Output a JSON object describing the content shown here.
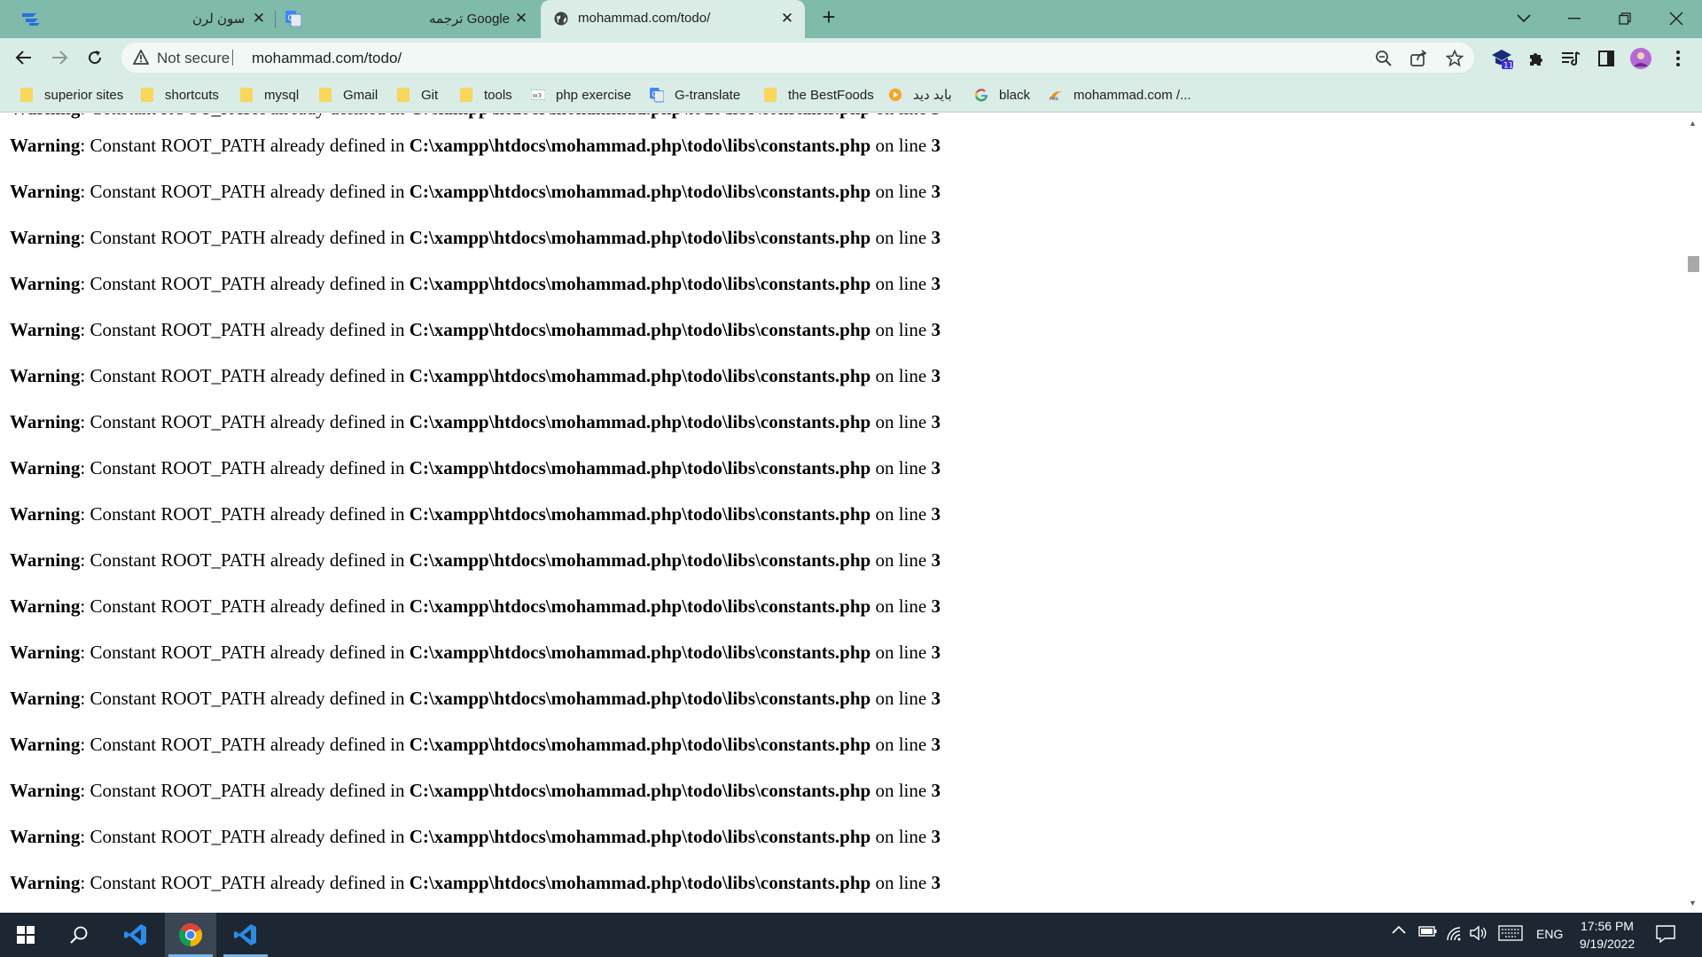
{
  "browser": {
    "tabs": [
      {
        "title": "سون لرن",
        "active": false
      },
      {
        "title": "ترجمه Google",
        "active": false
      },
      {
        "title": "mohammad.com/todo/",
        "active": true
      }
    ],
    "omnibox": {
      "security_label": "Not secure",
      "url": "mohammad.com/todo/"
    },
    "extension_badge": "11",
    "bookmarks": [
      {
        "label": "superior sites",
        "icon": "folder-icon"
      },
      {
        "label": "shortcuts",
        "icon": "folder-icon"
      },
      {
        "label": "mysql",
        "icon": "folder-icon"
      },
      {
        "label": "Gmail",
        "icon": "folder-icon"
      },
      {
        "label": "Git",
        "icon": "folder-icon"
      },
      {
        "label": "tools",
        "icon": "folder-icon"
      },
      {
        "label": "php exercise",
        "icon": "w3schools-icon"
      },
      {
        "label": "G-translate",
        "icon": "google-translate-icon"
      },
      {
        "label": "the BestFoods",
        "icon": "folder-icon"
      },
      {
        "label": "باید دید",
        "icon": "play-icon"
      },
      {
        "label": "black",
        "icon": "google-icon"
      },
      {
        "label": "mohammad.com /...",
        "icon": "phpmyadmin-icon"
      }
    ]
  },
  "page": {
    "warning": {
      "label": "Warning",
      "message": ": Constant ROOT_PATH already defined in ",
      "path": "C:\\xampp\\htdocs\\mohammad.php\\todo\\libs\\constants.php",
      "on_line": " on line ",
      "line_number": "3"
    },
    "warning_count": 17
  },
  "taskbar": {
    "language": "ENG",
    "time": "17:56 PM",
    "date": "9/19/2022"
  },
  "colors": {
    "tabstrip": "#7fbaab",
    "toolbar": "#d9ece6",
    "taskbar": "#1c2733"
  }
}
